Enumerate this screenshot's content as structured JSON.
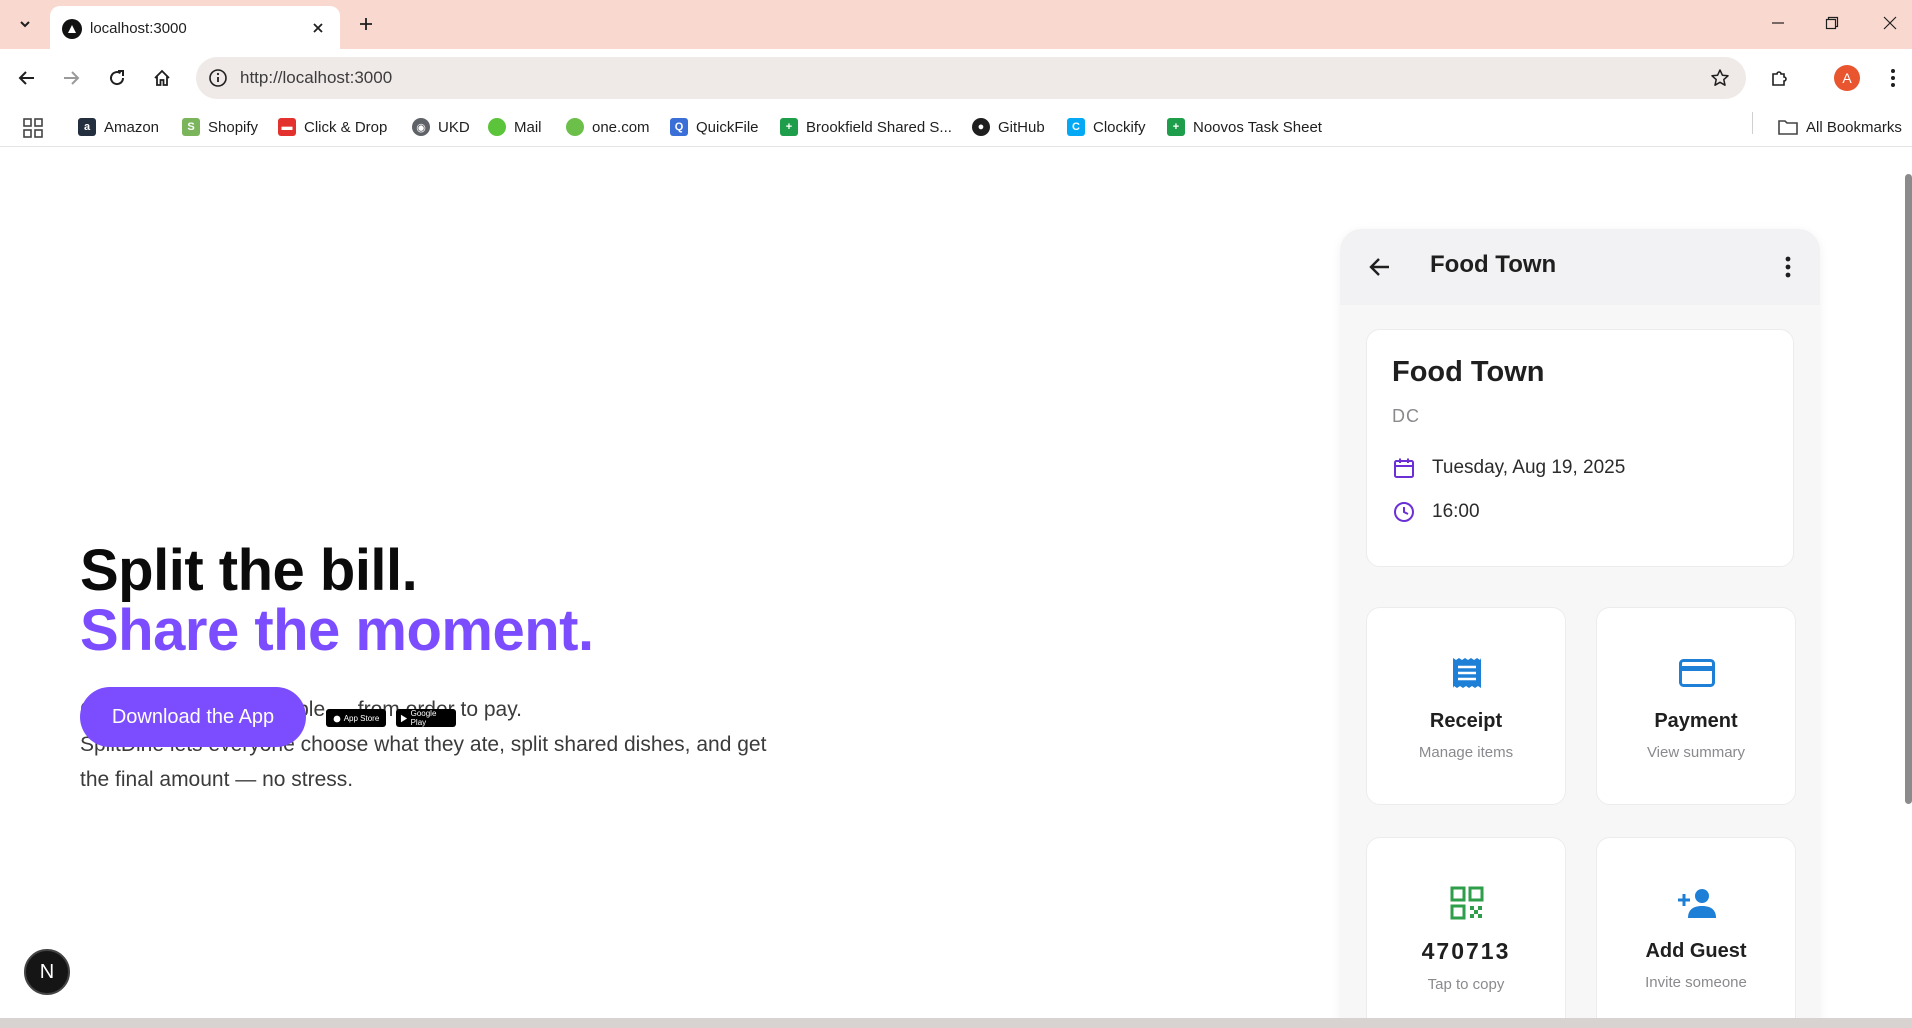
{
  "browser": {
    "tab_title": "localhost:3000",
    "url": "http://localhost:3000",
    "profile_initial": "A",
    "bookmarks": [
      {
        "label": "Amazon",
        "icon": "amazon-icon",
        "color": "#232f3e",
        "glyph": "a"
      },
      {
        "label": "Shopify",
        "icon": "shopify-icon",
        "color": "#7ab55c",
        "glyph": "S"
      },
      {
        "label": "Click & Drop",
        "icon": "royal-mail-icon",
        "color": "#e3322d",
        "glyph": "▬"
      },
      {
        "label": "UKD",
        "icon": "globe-icon",
        "color": "#5f6368",
        "glyph": "◉"
      },
      {
        "label": "Mail",
        "icon": "mail-icon",
        "color": "#5cc43a",
        "glyph": ""
      },
      {
        "label": "one.com",
        "icon": "onecom-icon",
        "color": "#6cc04a",
        "glyph": ""
      },
      {
        "label": "QuickFile",
        "icon": "quickfile-icon",
        "color": "#3b6fd8",
        "glyph": "Q"
      },
      {
        "label": "Brookfield Shared S...",
        "icon": "sheets-icon",
        "color": "#1e9e4a",
        "glyph": "+"
      },
      {
        "label": "GitHub",
        "icon": "github-icon",
        "color": "#1f1f1f",
        "glyph": "●"
      },
      {
        "label": "Clockify",
        "icon": "clockify-icon",
        "color": "#03a9f4",
        "glyph": "C"
      },
      {
        "label": "Noovos Task Sheet",
        "icon": "sheets-icon",
        "color": "#1e9e4a",
        "glyph": "+"
      }
    ],
    "all_bookmarks_label": "All Bookmarks"
  },
  "hero": {
    "title_line1": "Split the bill.",
    "title_line2": "Share the moment.",
    "desc_line1": "Group dining made simple — from order to pay.",
    "desc_line2": "SplitDine lets everyone choose what they ate, split shared dishes, and get the final amount — no stress.",
    "cta_label": "Download the App",
    "app_store_label": "App Store",
    "google_play_label": "Google Play",
    "accent_color": "#7b4dff"
  },
  "nextjs_badge": "N",
  "phone": {
    "header_title": "Food Town",
    "restaurant_name": "Food Town",
    "city": "DC",
    "date": "Tuesday, Aug 19, 2025",
    "time": "16:00",
    "tiles": {
      "receipt": {
        "title": "Receipt",
        "subtitle": "Manage items"
      },
      "payment": {
        "title": "Payment",
        "subtitle": "View summary"
      },
      "code": {
        "code": "470713",
        "subtitle": "Tap to copy"
      },
      "guest": {
        "title": "Add Guest",
        "subtitle": "Invite someone"
      }
    }
  }
}
